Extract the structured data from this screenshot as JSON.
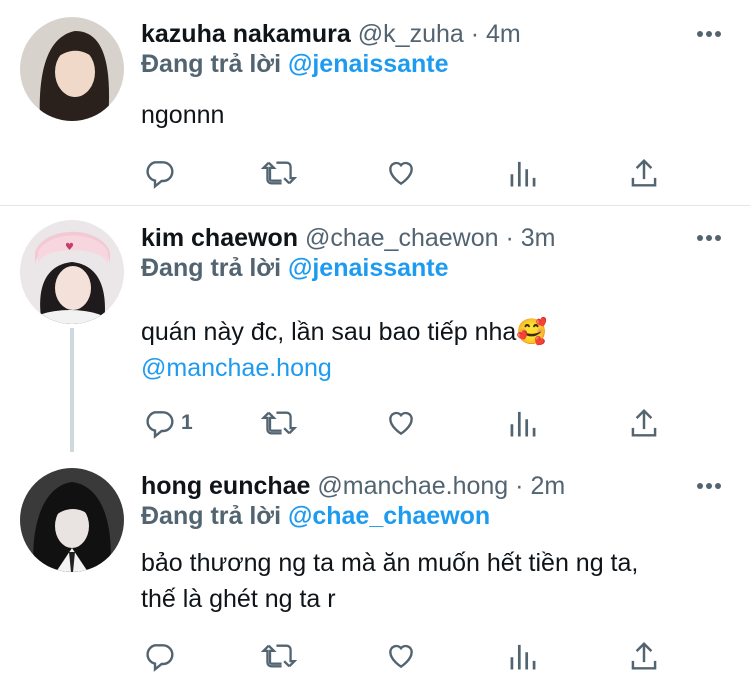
{
  "tweets": [
    {
      "name": "kazuha nakamura",
      "handle": "@k_zuha",
      "separator": "·",
      "time": "4m",
      "reply_prefix": "Đang trả lời",
      "reply_to": "@jenaissante",
      "text_lines": [
        "ngonnn"
      ],
      "reply_count": "",
      "avatar_icon": "avatar-photo"
    },
    {
      "name": "kim chaewon",
      "handle": "@chae_chaewon",
      "separator": "·",
      "time": "3m",
      "reply_prefix": "Đang trả lời",
      "reply_to": "@jenaissante",
      "text_lines": [
        "quán này đc, lần sau bao tiếp nha🥰"
      ],
      "text_mention": "@manchae.hong",
      "reply_count": "1",
      "avatar_icon": "avatar-photo"
    },
    {
      "name": "hong eunchae",
      "handle": "@manchae.hong",
      "separator": "·",
      "time": "2m",
      "reply_prefix": "Đang trả lời",
      "reply_to": "@chae_chaewon",
      "text_lines": [
        "bảo thương ng ta mà ăn muốn hết tiền ng ta,",
        "thế là ghét ng ta r"
      ],
      "reply_count": "",
      "avatar_icon": "avatar-photo"
    }
  ],
  "icons": {
    "reply": "reply-icon",
    "retweet": "retweet-icon",
    "like": "heart-icon",
    "views": "views-icon",
    "share": "share-icon",
    "more": "more-icon"
  },
  "colors": {
    "accent": "#1d9bf0",
    "secondary_text": "#536471",
    "primary_text": "#0f1419",
    "divider": "#e1e6ea"
  }
}
